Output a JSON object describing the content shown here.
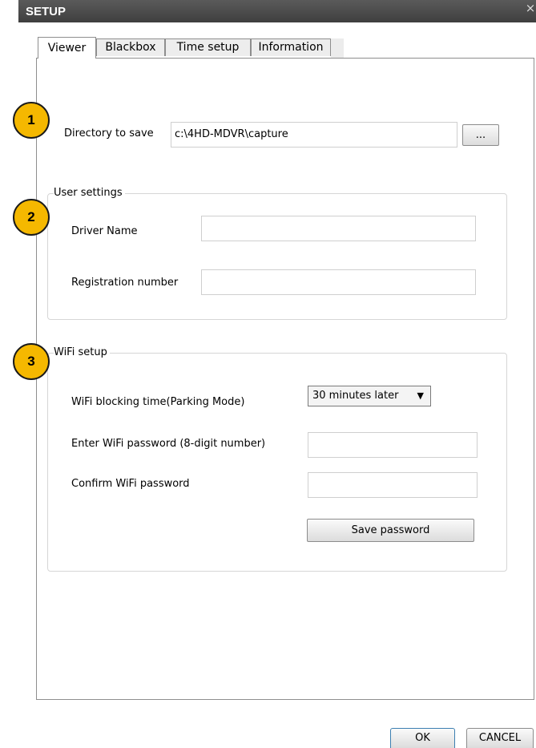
{
  "window": {
    "title": "SETUP",
    "close_glyph": "×"
  },
  "tabs": [
    {
      "label": "Viewer",
      "active": true
    },
    {
      "label": "Blackbox",
      "active": false
    },
    {
      "label": "Time setup",
      "active": false
    },
    {
      "label": "Information",
      "active": false
    }
  ],
  "badges": [
    "1",
    "2",
    "3"
  ],
  "directory": {
    "label": "Directory to save",
    "value": "c:\\4HD-MDVR\\capture",
    "browse_label": "..."
  },
  "user_settings": {
    "legend": "User settings",
    "driver_name_label": "Driver Name",
    "driver_name_value": "",
    "registration_label": "Registration number",
    "registration_value": ""
  },
  "wifi": {
    "legend": "WiFi setup",
    "blocking_label": "WiFi blocking time(Parking Mode)",
    "blocking_value": "30 minutes later",
    "password_label": "Enter WiFi password (8-digit number)",
    "password_value": "",
    "confirm_label": "Confirm WiFi password",
    "confirm_value": "",
    "save_label": "Save password"
  },
  "footer": {
    "ok_label": "OK",
    "cancel_label": "CANCEL"
  },
  "colors": {
    "badge": "#f5b800",
    "titlebar": "#4a4a4a",
    "ok_border": "#3c7fb1"
  }
}
